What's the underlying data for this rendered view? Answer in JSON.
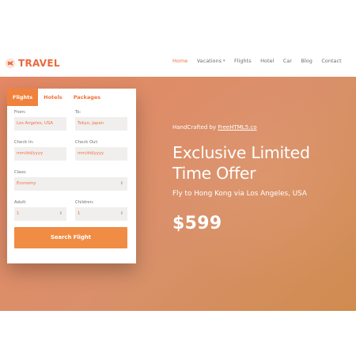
{
  "brand": {
    "name": "TRAVEL",
    "icon": "airplane-icon",
    "color": "#e86a3e"
  },
  "nav": {
    "items": [
      {
        "label": "Home",
        "active": true
      },
      {
        "label": "Vacations",
        "has_dropdown": true
      },
      {
        "label": "Flights"
      },
      {
        "label": "Hotel"
      },
      {
        "label": "Car"
      },
      {
        "label": "Blog"
      },
      {
        "label": "Contact"
      }
    ]
  },
  "search_form": {
    "tabs": [
      {
        "label": "Flights",
        "active": true
      },
      {
        "label": "Hotels"
      },
      {
        "label": "Packages"
      }
    ],
    "from": {
      "label": "From:",
      "value": "Los Angeles, USA"
    },
    "to": {
      "label": "To:",
      "value": "Tokyo, Japan"
    },
    "check_in": {
      "label": "Check In:",
      "placeholder": "mm/dd/yyyy"
    },
    "check_out": {
      "label": "Check Out:",
      "placeholder": "mm/dd/yyyy"
    },
    "class": {
      "label": "Class:",
      "value": "Economy"
    },
    "adult": {
      "label": "Adult:",
      "value": "1"
    },
    "children": {
      "label": "Children:",
      "value": "1"
    },
    "submit_label": "Search Flight"
  },
  "hero": {
    "credit_prefix": "HandCrafted by",
    "credit_link": "FreeHTML5.co",
    "headline": "Exclusive Limited Time Offer",
    "subline": "Fly to Hong Kong via Los Angeles, USA",
    "price": "$599"
  },
  "colors": {
    "accent": "#f0733a",
    "button": "#f08c44",
    "hero_start": "#e48865",
    "hero_end": "#cf8c4f"
  }
}
